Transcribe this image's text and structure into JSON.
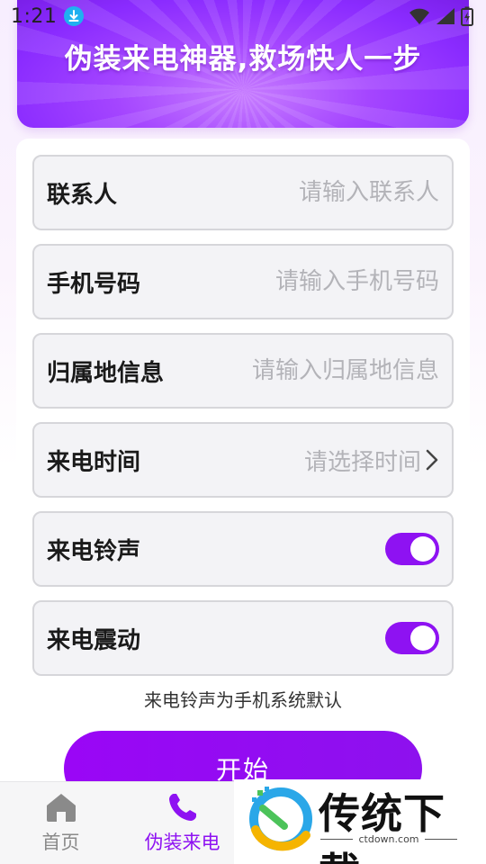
{
  "status_bar": {
    "time": "1:21"
  },
  "banner": {
    "title": "伪装来电神器,救场快人一步"
  },
  "form": {
    "fields": [
      {
        "label": "联系人",
        "placeholder": "请输入联系人"
      },
      {
        "label": "手机号码",
        "placeholder": "请输入手机号码"
      },
      {
        "label": "归属地信息",
        "placeholder": "请输入归属地信息"
      }
    ],
    "time_picker": {
      "label": "来电时间",
      "placeholder": "请选择时间"
    },
    "ringtone": {
      "label": "来电铃声",
      "enabled": true
    },
    "vibration": {
      "label": "来电震动",
      "enabled": true
    },
    "note": "来电铃声为手机系统默认",
    "start_button": "开始"
  },
  "tab_bar": {
    "items": [
      {
        "label": "首页",
        "icon": "home-icon",
        "active": false
      },
      {
        "label": "伪装来电",
        "icon": "phone-icon",
        "active": true
      }
    ],
    "active_color": "#8e12f2",
    "inactive_color": "#8a8a8a"
  },
  "watermark": {
    "brand": "传统下载",
    "url": "ctdown.com"
  },
  "colors": {
    "accent": "#8e12f2",
    "banner": "#a445ff"
  }
}
